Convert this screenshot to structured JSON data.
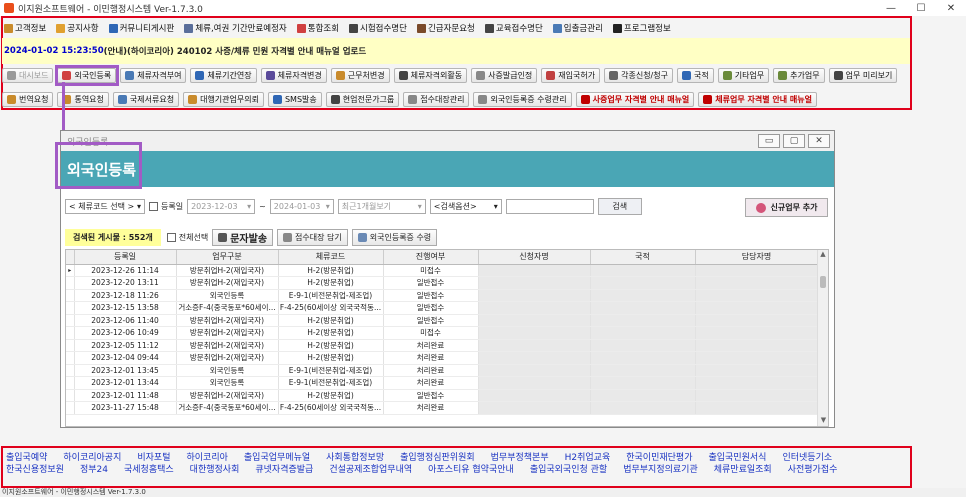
{
  "window": {
    "title": "이지원소프트웨어 - 이민행정시스템 Ver-1.7.3.0",
    "minimize": "—",
    "maximize": "☐",
    "close": "✕"
  },
  "menu": [
    {
      "label": "고객정보",
      "color": "#c98b2c"
    },
    {
      "label": "공지사항",
      "color": "#e0a030"
    },
    {
      "label": "커뮤니티게시판",
      "color": "#2f67b5"
    },
    {
      "label": "체류,여권 기간만료예정자",
      "color": "#5a6e9a"
    },
    {
      "label": "통합조회",
      "color": "#d04040"
    },
    {
      "label": "시험접수명단",
      "color": "#444"
    },
    {
      "label": "긴급자문요청",
      "color": "#7a4a2a"
    },
    {
      "label": "교육접수명단",
      "color": "#444"
    },
    {
      "label": "입출금관리",
      "color": "#4a7ab5"
    },
    {
      "label": "프로그램정보",
      "color": "#222"
    }
  ],
  "notice": {
    "date": "2024-01-02 15:23:50",
    "text": "(안내)(하이코리아) 240102 사증/체류 민원 자격별 안내 매뉴얼 업로드"
  },
  "toolbar1": [
    {
      "label": "대시보드",
      "color": "#999",
      "disabled": true
    },
    {
      "label": "외국인등록",
      "color": "#d04040"
    },
    {
      "label": "체류자격부여",
      "color": "#4a7ab5"
    },
    {
      "label": "체류기간연장",
      "color": "#2f67b5"
    },
    {
      "label": "체류자격변경",
      "color": "#5a4a9a"
    },
    {
      "label": "근무처변경",
      "color": "#c98b2c"
    },
    {
      "label": "체류자격외활동",
      "color": "#444"
    },
    {
      "label": "사증발급인정",
      "color": "#888"
    },
    {
      "label": "재입국허가",
      "color": "#c04040"
    },
    {
      "label": "각종신청/청구",
      "color": "#666"
    },
    {
      "label": "국적",
      "color": "#2f67b5"
    },
    {
      "label": "기타업무",
      "color": "#6a8a3a"
    },
    {
      "label": "추가업무",
      "color": "#6a8a3a"
    },
    {
      "label": "업무 미리보기",
      "color": "#444"
    }
  ],
  "toolbar2": [
    {
      "label": "번역요청",
      "color": "#c98b2c"
    },
    {
      "label": "통역요청",
      "color": "#c98b2c"
    },
    {
      "label": "국제서류요청",
      "color": "#4a7ab5"
    },
    {
      "label": "대행기관업무의뢰",
      "color": "#c98b2c"
    },
    {
      "label": "SMS발송",
      "color": "#2f67b5"
    },
    {
      "label": "현업전문가그룹",
      "color": "#444"
    },
    {
      "label": "접수대장관리",
      "color": "#888"
    },
    {
      "label": "외국인등록증 수령관리",
      "color": "#888"
    },
    {
      "label": "사증업무 자격별 안내 매뉴얼",
      "color": "#c00000",
      "red": true
    },
    {
      "label": "체류업무 자격별 안내 매뉴얼",
      "color": "#c00000",
      "red": true
    }
  ],
  "dialog": {
    "title": "외국인등록",
    "header": "외국인등록",
    "filters": {
      "code_select": "< 체류코드 선택 >",
      "reg_date_label": "등록일",
      "date_from": "2023-12-03",
      "date_sep": "~",
      "date_to": "2024-01-03",
      "period": "최근1개월보기",
      "search_option": "<검색옵션>",
      "search_value": "",
      "search_button": "검색",
      "new_button": "신규업무 추가"
    },
    "actions": {
      "count": "검색된 게시물 : 552개",
      "select_all": "전체선택",
      "sms": "문자발송",
      "register_log": "접수대장 담기",
      "card_receive": "외국인등록증 수령"
    },
    "columns": [
      "등록일",
      "업무구분",
      "체류코드",
      "진행여부",
      "신청자명",
      "국적",
      "담당자명"
    ],
    "rows": [
      {
        "date": "2023-12-26 11:14",
        "type": "방문취업H-2(재입국자)",
        "code": "H-2(방문취업)",
        "status": "미접수"
      },
      {
        "date": "2023-12-20 13:11",
        "type": "방문취업H-2(재입국자)",
        "code": "H-2(방문취업)",
        "status": "일반접수"
      },
      {
        "date": "2023-12-18 11:26",
        "type": "외국인등록",
        "code": "E-9-1(비전문취업-제조업)",
        "status": "일반접수"
      },
      {
        "date": "2023-12-15 13:58",
        "type": "거소증F-4(중국동포*60세이...",
        "code": "F-4-25(60세이상 외국국적동...",
        "status": "일반접수"
      },
      {
        "date": "2023-12-06 11:40",
        "type": "방문취업H-2(재입국자)",
        "code": "H-2(방문취업)",
        "status": "일반접수"
      },
      {
        "date": "2023-12-06 10:49",
        "type": "방문취업H-2(재입국자)",
        "code": "H-2(방문취업)",
        "status": "미접수"
      },
      {
        "date": "2023-12-05 11:12",
        "type": "방문취업H-2(재입국자)",
        "code": "H-2(방문취업)",
        "status": "처리완료"
      },
      {
        "date": "2023-12-04 09:44",
        "type": "방문취업H-2(재입국자)",
        "code": "H-2(방문취업)",
        "status": "처리완료"
      },
      {
        "date": "2023-12-01 13:45",
        "type": "외국인등록",
        "code": "E-9-1(비전문취업-제조업)",
        "status": "처리완료"
      },
      {
        "date": "2023-12-01 13:44",
        "type": "외국인등록",
        "code": "E-9-1(비전문취업-제조업)",
        "status": "처리완료"
      },
      {
        "date": "2023-12-01 11:48",
        "type": "방문취업H-2(재입국자)",
        "code": "H-2(방문취업)",
        "status": "일반접수"
      },
      {
        "date": "2023-11-27 15:48",
        "type": "거소증F-4(중국동포*60세이...",
        "code": "F-4-25(60세이상 외국국적동...",
        "status": "처리완료"
      }
    ]
  },
  "links": {
    "row1": [
      "출입국예약",
      "하이코리아공지",
      "비자포털",
      "하이코리아",
      "출입국업무메뉴얼",
      "사회통합정보망",
      "출입행정심판위원회",
      "법무부정책본부",
      "H2취업교육",
      "한국이민재단평가",
      "출입국민원서식",
      "인터넷등기소"
    ],
    "row2": [
      "한국신용정보원",
      "정부24",
      "국세청홈택스",
      "대한행정사회",
      "큐넷자격증발급",
      "건설공제조합업무내역",
      "아포스티유 협약국안내",
      "출입국외국인청 관할",
      "법무부지정의료기관",
      "체류만료일조회",
      "사전평가접수"
    ]
  },
  "status": "이지원소프트웨어 - 이민행정시스템 Ver-1.7.3.0"
}
